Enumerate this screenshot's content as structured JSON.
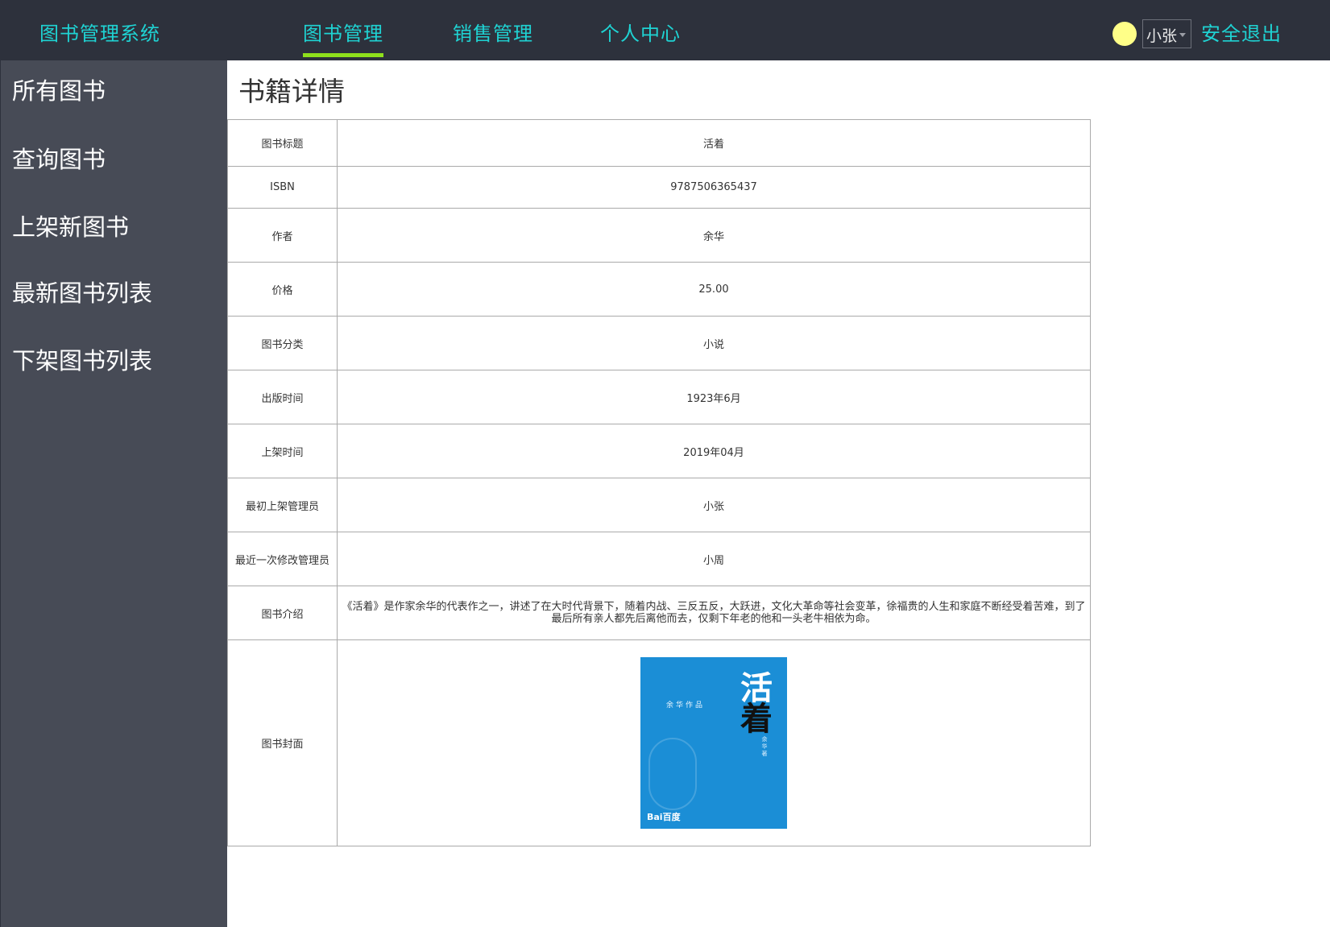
{
  "header": {
    "brand": "图书管理系统",
    "nav": [
      {
        "label": "图书管理",
        "active": true
      },
      {
        "label": "销售管理",
        "active": false
      },
      {
        "label": "个人中心",
        "active": false
      }
    ],
    "user": {
      "name": "小张"
    },
    "logout_label": "安全退出"
  },
  "sidebar": {
    "items": [
      {
        "label": "所有图书"
      },
      {
        "label": "查询图书"
      },
      {
        "label": "上架新图书"
      },
      {
        "label": "最新图书列表"
      },
      {
        "label": "下架图书列表"
      }
    ]
  },
  "main": {
    "title": "书籍详情",
    "rows": [
      {
        "label": "图书标题",
        "value": "活着"
      },
      {
        "label": "ISBN",
        "value": "9787506365437"
      },
      {
        "label": "作者",
        "value": "余华"
      },
      {
        "label": "价格",
        "value": "25.00"
      },
      {
        "label": "图书分类",
        "value": "小说"
      },
      {
        "label": "出版时间",
        "value": "1923年6月"
      },
      {
        "label": "上架时间",
        "value": "2019年04月"
      },
      {
        "label": "最初上架管理员",
        "value": "小张"
      },
      {
        "label": "最近一次修改管理员",
        "value": "小周"
      },
      {
        "label": "图书介绍",
        "value": "《活着》是作家余华的代表作之一，讲述了在大时代背景下，随着内战、三反五反，大跃进，文化大革命等社会变革，徐福贵的人生和家庭不断经受着苦难，到了最后所有亲人都先后离他而去，仅剩下年老的他和一头老牛相依为命。"
      }
    ],
    "cover_row": {
      "label": "图书封面",
      "cover": {
        "title_chars": [
          "活",
          "着"
        ],
        "author_line": "余华作品",
        "byline": "余华著",
        "logo": "Bai百度"
      }
    }
  },
  "colors": {
    "header_bg": "#2d313c",
    "sidebar_bg": "#474b56",
    "accent": "#1fd3d3",
    "active_underline": "#8fe01c",
    "avatar": "#ffff88",
    "cover_bg": "#1b8ed6"
  }
}
